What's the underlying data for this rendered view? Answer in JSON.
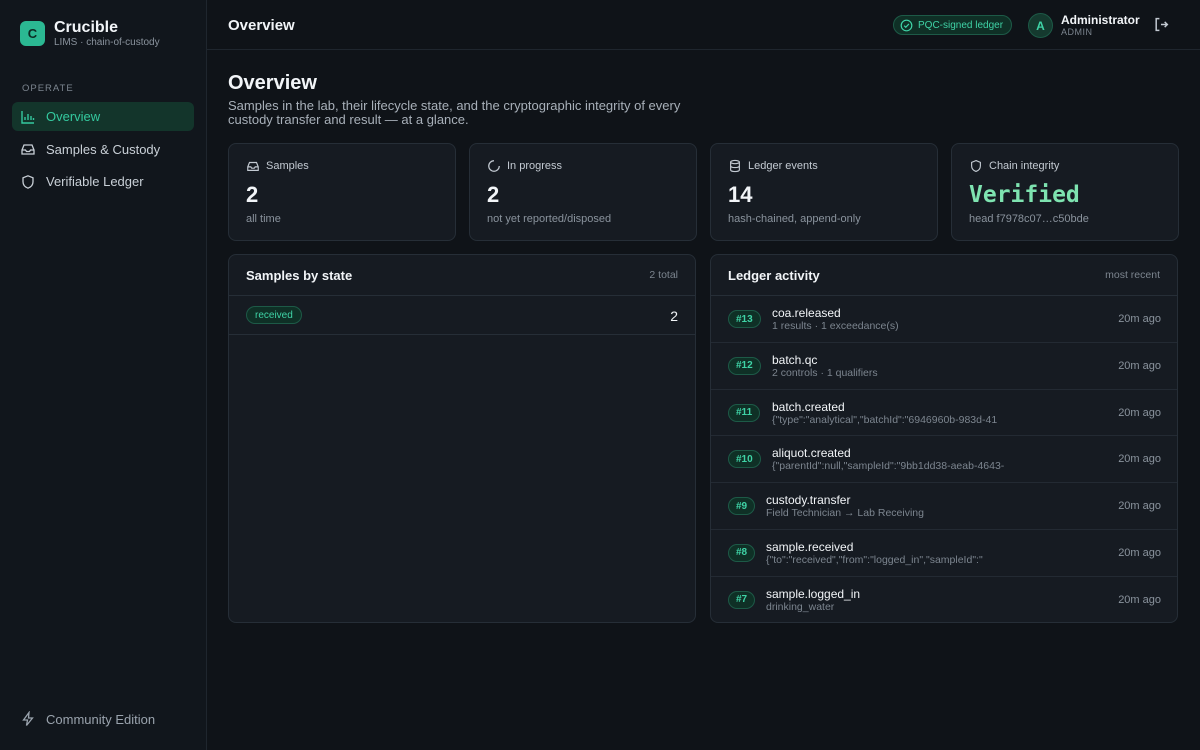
{
  "brand": {
    "logo_letter": "C",
    "name": "Crucible",
    "subtitle": "LIMS · chain-of-custody"
  },
  "sidebar": {
    "section_label": "OPERATE",
    "items": [
      {
        "label": "Overview",
        "icon": "bar-chart-icon",
        "active": true
      },
      {
        "label": "Samples & Custody",
        "icon": "inbox-icon",
        "active": false
      },
      {
        "label": "Verifiable Ledger",
        "icon": "shield-icon",
        "active": false
      }
    ],
    "edition": "Community Edition"
  },
  "topbar": {
    "title": "Overview",
    "badge": "PQC-signed ledger",
    "avatar_letter": "A",
    "user_name": "Administrator",
    "user_role": "ADMIN"
  },
  "page": {
    "title": "Overview",
    "description": "Samples in the lab, their lifecycle state, and the cryptographic integrity of every custody transfer and result — at a glance."
  },
  "stats": [
    {
      "label": "Samples",
      "value": "2",
      "sub": "all time",
      "icon": "inbox-icon"
    },
    {
      "label": "In progress",
      "value": "2",
      "sub": "not yet reported/disposed",
      "icon": "spinner-icon"
    },
    {
      "label": "Ledger events",
      "value": "14",
      "sub": "hash-chained, append-only",
      "icon": "database-icon"
    },
    {
      "label": "Chain integrity",
      "value": "Verified",
      "sub": "head f7978c07…c50bde",
      "icon": "shield-icon"
    }
  ],
  "samples_by_state": {
    "title": "Samples by state",
    "meta": "2 total",
    "rows": [
      {
        "state": "received",
        "count": "2"
      }
    ]
  },
  "ledger_activity": {
    "title": "Ledger activity",
    "meta": "most recent",
    "rows": [
      {
        "id": "#13",
        "event": "coa.released",
        "detail": "1 results · 1 exceedance(s)",
        "time": "20m ago"
      },
      {
        "id": "#12",
        "event": "batch.qc",
        "detail": "2 controls · 1 qualifiers",
        "time": "20m ago"
      },
      {
        "id": "#11",
        "event": "batch.created",
        "detail": "{\"type\":\"analytical\",\"batchId\":\"6946960b-983d-41",
        "time": "20m ago"
      },
      {
        "id": "#10",
        "event": "aliquot.created",
        "detail": "{\"parentId\":null,\"sampleId\":\"9bb1dd38-aeab-4643-",
        "time": "20m ago"
      },
      {
        "id": "#9",
        "event": "custody.transfer",
        "detail": "Field Technician → Lab Receiving",
        "time": "20m ago"
      },
      {
        "id": "#8",
        "event": "sample.received",
        "detail": "{\"to\":\"received\",\"from\":\"logged_in\",\"sampleId\":\"",
        "time": "20m ago"
      },
      {
        "id": "#7",
        "event": "sample.logged_in",
        "detail": "drinking_water",
        "time": "20m ago"
      }
    ]
  }
}
